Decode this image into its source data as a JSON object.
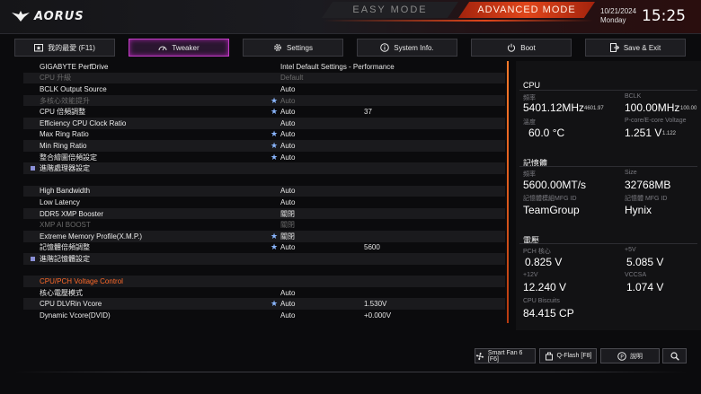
{
  "header": {
    "logo_text": "AORUS",
    "easy_mode": "EASY MODE",
    "advanced_mode": "ADVANCED MODE",
    "date": "10/21/2024",
    "weekday": "Monday",
    "time": "15:25"
  },
  "tabs": [
    {
      "label": "我的最愛 (F11)",
      "icon": "star-folder-icon"
    },
    {
      "label": "Tweaker",
      "icon": "speedometer-icon"
    },
    {
      "label": "Settings",
      "icon": "gear-icon"
    },
    {
      "label": "System Info.",
      "icon": "info-icon"
    },
    {
      "label": "Boot",
      "icon": "power-icon"
    },
    {
      "label": "Save & Exit",
      "icon": "exit-icon"
    }
  ],
  "settings": [
    {
      "label": "GIGABYTE PerfDrive",
      "value": "Intel Default Settings - Performance",
      "value2": "",
      "star": false,
      "dim": false,
      "sq": false
    },
    {
      "label": "CPU 升級",
      "value": "Default",
      "value2": "",
      "star": false,
      "dim": true,
      "sq": false
    },
    {
      "label": "BCLK Output Source",
      "value": "Auto",
      "value2": "",
      "star": false,
      "dim": false,
      "sq": false
    },
    {
      "label": "多核心效能提升",
      "value": "Auto",
      "value2": "",
      "star": true,
      "dim": true,
      "sq": false
    },
    {
      "label": "CPU 倍頻調整",
      "value": "Auto",
      "value2": "37",
      "star": true,
      "dim": false,
      "sq": false
    },
    {
      "label": "Efficiency CPU Clock Ratio",
      "value": "Auto",
      "value2": "",
      "star": false,
      "dim": false,
      "sq": false
    },
    {
      "label": "Max Ring Ratio",
      "value": "Auto",
      "value2": "",
      "star": true,
      "dim": false,
      "sq": false
    },
    {
      "label": "Min Ring Ratio",
      "value": "Auto",
      "value2": "",
      "star": true,
      "dim": false,
      "sq": false
    },
    {
      "label": "整合繪圖倍頻設定",
      "value": "Auto",
      "value2": "",
      "star": true,
      "dim": false,
      "sq": false
    },
    {
      "label": "進階處理器設定",
      "value": "",
      "value2": "",
      "star": false,
      "dim": false,
      "sq": true
    },
    {
      "label": "",
      "value": "",
      "value2": "",
      "star": false,
      "dim": false,
      "sq": false
    },
    {
      "label": "High Bandwidth",
      "value": "Auto",
      "value2": "",
      "star": false,
      "dim": false,
      "sq": false
    },
    {
      "label": "Low Latency",
      "value": "Auto",
      "value2": "",
      "star": false,
      "dim": false,
      "sq": false
    },
    {
      "label": "DDR5 XMP Booster",
      "value": "關閉",
      "value2": "",
      "star": false,
      "dim": false,
      "sq": false
    },
    {
      "label": "XMP AI BOOST",
      "value": "關閉",
      "value2": "",
      "star": false,
      "dim": true,
      "sq": false
    },
    {
      "label": "Extreme Memory Profile(X.M.P.)",
      "value": "關閉",
      "value2": "",
      "star": true,
      "dim": false,
      "sq": false
    },
    {
      "label": "記憶體倍頻調整",
      "value": "Auto",
      "value2": "5600",
      "star": true,
      "dim": false,
      "sq": false
    },
    {
      "label": "進階記憶體設定",
      "value": "",
      "value2": "",
      "star": false,
      "dim": false,
      "sq": true
    },
    {
      "label": "",
      "value": "",
      "value2": "",
      "star": false,
      "dim": false,
      "sq": false
    },
    {
      "label": "CPU/PCH Voltage Control",
      "value": "",
      "value2": "",
      "star": false,
      "dim": false,
      "sq": false,
      "orange": true
    },
    {
      "label": "核心電壓模式",
      "value": "Auto",
      "value2": "",
      "star": false,
      "dim": false,
      "sq": false
    },
    {
      "label": "CPU DLVRin Vcore",
      "value": "Auto",
      "value2": "1.530V",
      "star": true,
      "dim": false,
      "sq": false
    },
    {
      "label": "Dynamic Vcore(DVID)",
      "value": "Auto",
      "value2": "+0.000V",
      "star": false,
      "dim": false,
      "sq": false
    }
  ],
  "panel": {
    "cpu": {
      "title": "CPU",
      "freq_label": "頻率",
      "freq_value": "5401.12MHz",
      "freq_sub": "4601.97",
      "bclk_label": "BCLK",
      "bclk_value": "100.00MHz",
      "bclk_sub": "100.00",
      "temp_label": "溫度",
      "temp_value": "60.0 °C",
      "volt_label": "P-core/E-core Voltage",
      "volt_value": "1.251 V",
      "volt_sub": "1.122"
    },
    "memory": {
      "title": "記憶體",
      "freq_label": "頻率",
      "freq_value": "5600.00MT/s",
      "size_label": "Size",
      "size_value": "32768MB",
      "module_label": "記憶體模組MFG ID",
      "module_value": "TeamGroup",
      "chip_label": "記憶體 MFG ID",
      "chip_value": "Hynix"
    },
    "voltage": {
      "title": "電壓",
      "pch_label": "PCH 核心",
      "pch_value": "0.825 V",
      "v5_label": "+5V",
      "v5_value": "5.085 V",
      "v12_label": "+12V",
      "v12_value": "12.240 V",
      "vccsa_label": "VCCSA",
      "vccsa_value": "1.074 V",
      "biscuits_label": "CPU Biscuits",
      "biscuits_value": "84.415 CP"
    }
  },
  "bottom": {
    "smartfan": "Smart Fan 6 [F6]",
    "qflash": "Q-Flash [F8]",
    "help": "說明"
  },
  "colors": {
    "accent": "#e0461b",
    "tab_active": "#c23cc6",
    "section": "#ff6a2a",
    "star": "#8ab6ff"
  }
}
